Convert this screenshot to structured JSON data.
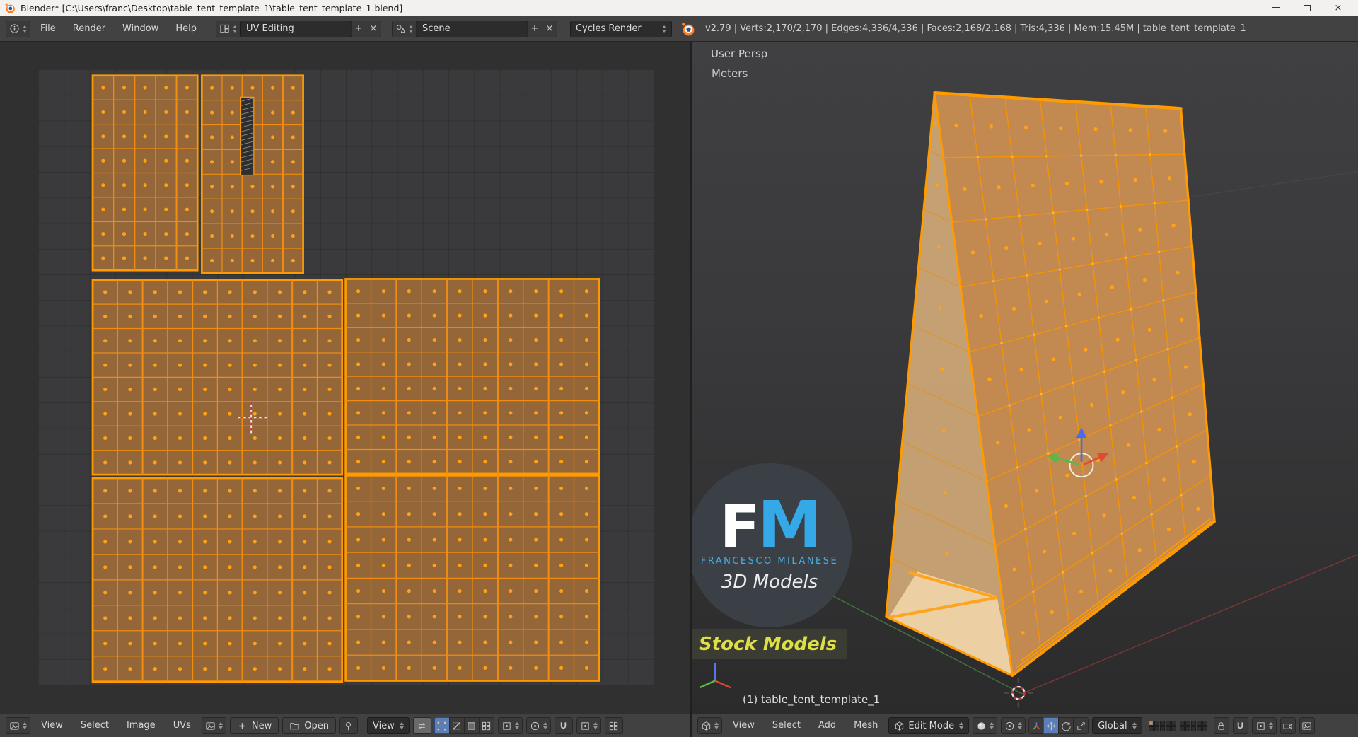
{
  "window": {
    "title": "Blender* [C:\\Users\\franc\\Desktop\\table_tent_template_1\\table_tent_template_1.blend]",
    "controls": {
      "close": "×"
    }
  },
  "topbar": {
    "menus": [
      "File",
      "Render",
      "Window",
      "Help"
    ],
    "layout": {
      "value": "UV Editing",
      "add": "+",
      "close": "×"
    },
    "scene": {
      "value": "Scene",
      "add": "+",
      "close": "×"
    },
    "engine": "Cycles Render",
    "stats": "v2.79 | Verts:2,170/2,170 | Edges:4,336/4,336 | Faces:2,168/2,168 | Tris:4,336 | Mem:15.45M | table_tent_template_1"
  },
  "uv_editor": {
    "menus": [
      "View",
      "Select",
      "Image",
      "UVs"
    ],
    "new_button": "New",
    "open_button": "Open",
    "view_dropdown": "View"
  },
  "view3d": {
    "overlay": {
      "view_name": "User Persp",
      "unit": "Meters",
      "object_info": "(1) table_tent_template_1"
    },
    "menus": [
      "View",
      "Select",
      "Add",
      "Mesh"
    ],
    "mode_dropdown": "Edit Mode",
    "orientation_dropdown": "Global"
  },
  "watermark": {
    "initial_f": "F",
    "initial_m": "M",
    "name": "FRANCESCO MILANESE",
    "tagline": "3D Models",
    "banner": "Stock Models"
  },
  "colors": {
    "selection_orange": "#ff9b00",
    "mesh_fill": "#c28a50",
    "watermark_blue": "#35a8e8",
    "banner_yellow": "#dede46"
  }
}
